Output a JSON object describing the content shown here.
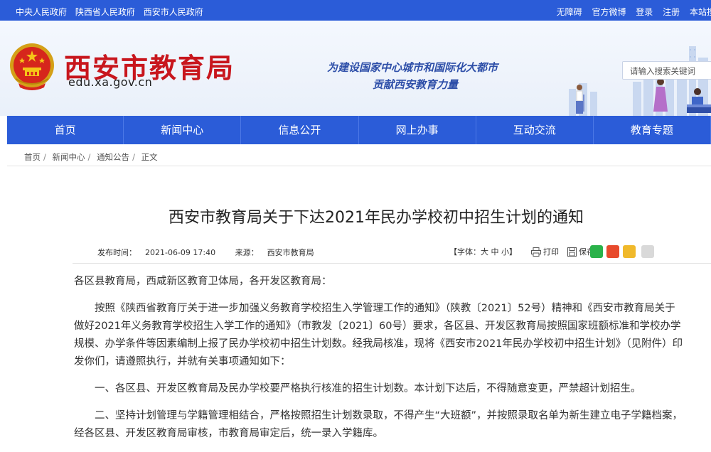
{
  "topbar": {
    "left_links": [
      "中央人民政府",
      "陕西省人民政府",
      "西安市人民政府"
    ],
    "right_links": [
      "无障碍",
      "官方微博",
      "登录",
      "注册",
      "本站搜"
    ]
  },
  "header": {
    "site_title": "西安市教育局",
    "site_url": "edu.xa.gov.cn",
    "slogan_line1": "为建设国家中心城市和国际化大都市",
    "slogan_line2": "贡献西安教育力量",
    "search_placeholder": "请输入搜索关键词"
  },
  "nav": {
    "items": [
      "首页",
      "新闻中心",
      "信息公开",
      "网上办事",
      "互动交流",
      "教育专题"
    ]
  },
  "breadcrumb": [
    "首页",
    "新闻中心",
    "通知公告",
    "正文"
  ],
  "article": {
    "title": "西安市教育局关于下达2021年民办学校初中招生计划的通知",
    "publish_label": "发布时间：",
    "publish_time": "2021-06-09 17:40",
    "source_label": "来源：",
    "source": "西安市教育局",
    "font_size": "【字体：大 中 小】",
    "print_label": "打印",
    "save_label": "保存",
    "paragraphs": [
      "各区县教育局，西咸新区教育卫体局，各开发区教育局：",
      "按照《陕西省教育厅关于进一步加强义务教育学校招生入学管理工作的通知》（陕教〔2021〕52号）精神和《西安市教育局关于做好2021年义务教育学校招生入学工作的通知》（市教发〔2021〕60号）要求，各区县、开发区教育局按照国家班额标准和学校办学规模、办学条件等因素编制上报了民办学校初中招生计划数。经我局核准，现将《西安市2021年民办学校初中招生计划》（见附件）印发你们，请遵照执行，并就有关事项通知如下：",
      "一、各区县、开发区教育局及民办学校要严格执行核准的招生计划数。本计划下达后，不得随意变更，严禁超计划招生。",
      "二、坚持计划管理与学籍管理相结合，严格按照招生计划数录取，不得产生“大班额”，并按照录取名单为新生建立电子学籍档案，经各区县、开发区教育局审核，市教育局审定后，统一录入学籍库。"
    ]
  },
  "colors": {
    "primary_blue": "#2b5cd8",
    "title_red": "#c8161d"
  }
}
